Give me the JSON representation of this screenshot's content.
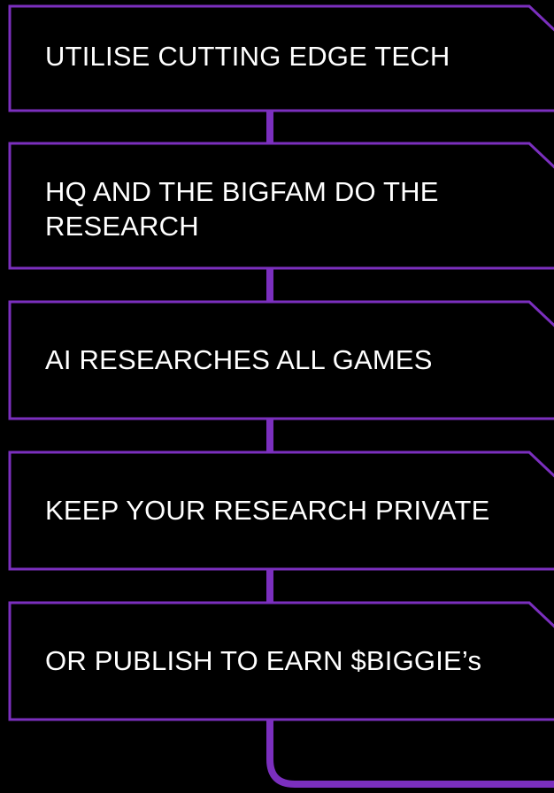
{
  "colors": {
    "background": "#000000",
    "accent": "#7b2fbe",
    "text": "#ffffff"
  },
  "steps": [
    {
      "label": "UTILISE CUTTING EDGE TECH"
    },
    {
      "label": "HQ AND THE BIGFAM DO THE RESEARCH"
    },
    {
      "label": "AI RESEARCHES ALL GAMES"
    },
    {
      "label": "KEEP YOUR RESEARCH PRIVATE"
    },
    {
      "label": "OR PUBLISH TO EARN $BIGGIE’s"
    }
  ]
}
